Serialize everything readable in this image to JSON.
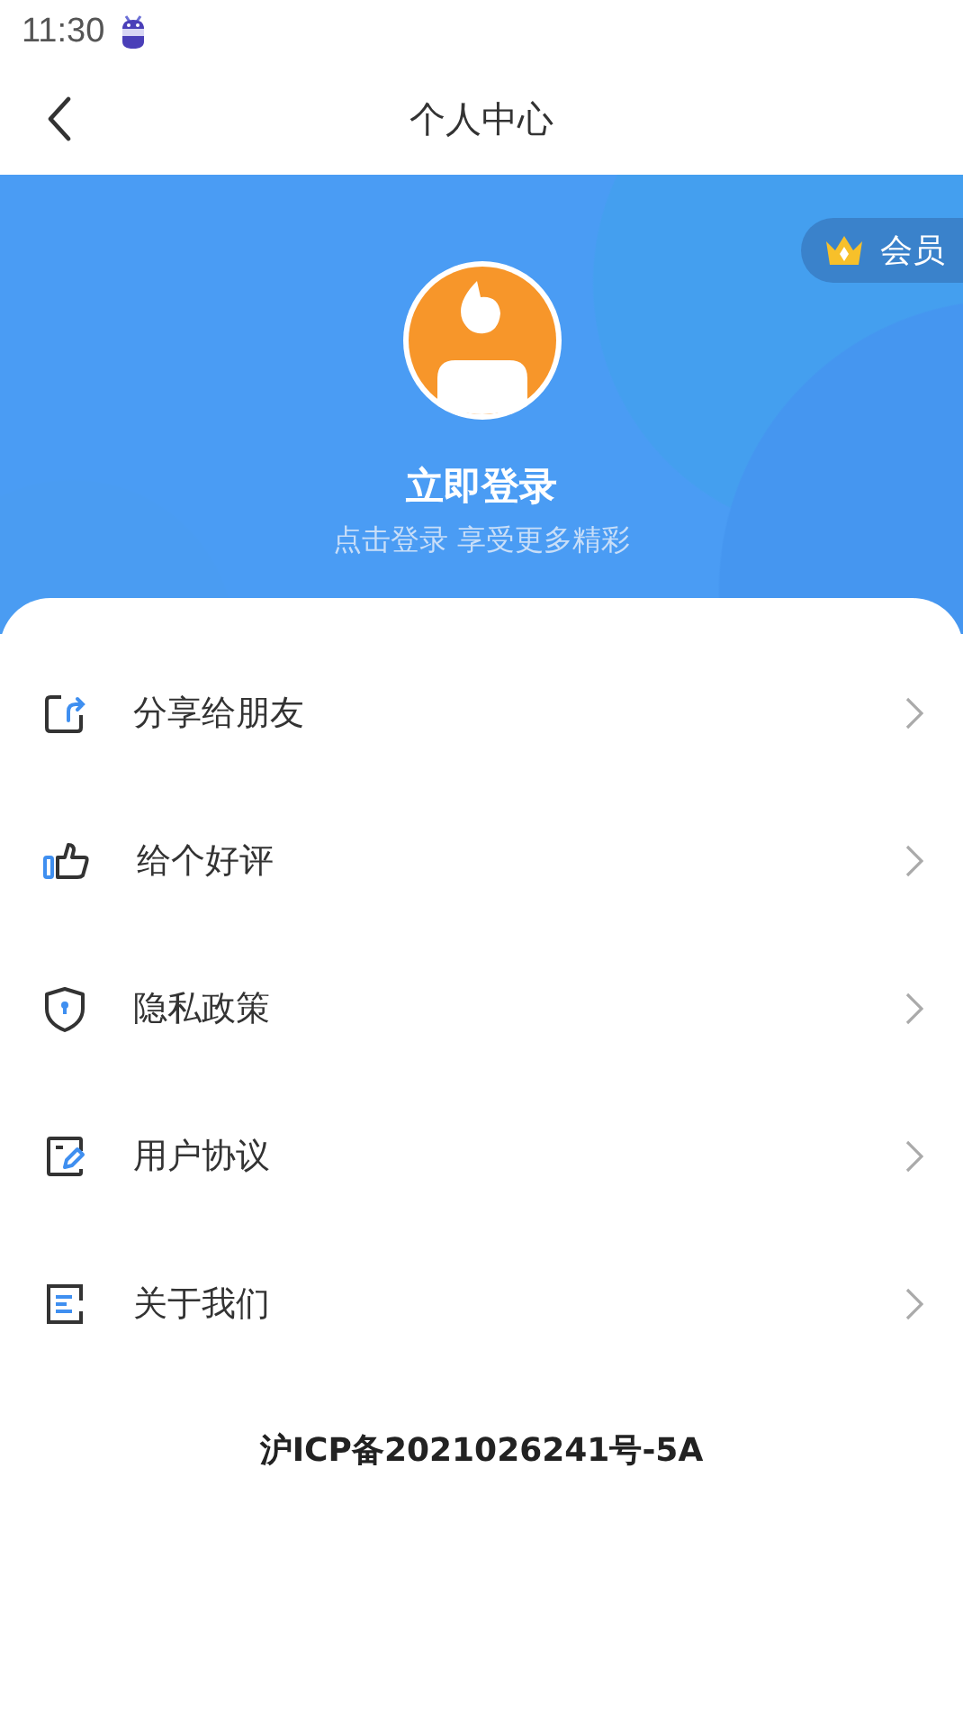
{
  "status_bar": {
    "time": "11:30"
  },
  "nav": {
    "title": "个人中心"
  },
  "header": {
    "member_badge": "会员",
    "login_title": "立即登录",
    "login_subtitle": "点击登录 享受更多精彩"
  },
  "menu": [
    {
      "kind": "share",
      "label": "分享给朋友"
    },
    {
      "kind": "like",
      "label": "给个好评"
    },
    {
      "kind": "privacy",
      "label": "隐私政策"
    },
    {
      "kind": "agreement",
      "label": "用户协议"
    },
    {
      "kind": "about",
      "label": "关于我们"
    }
  ],
  "footer": {
    "icp": "沪ICP备2021026241号-5A"
  }
}
